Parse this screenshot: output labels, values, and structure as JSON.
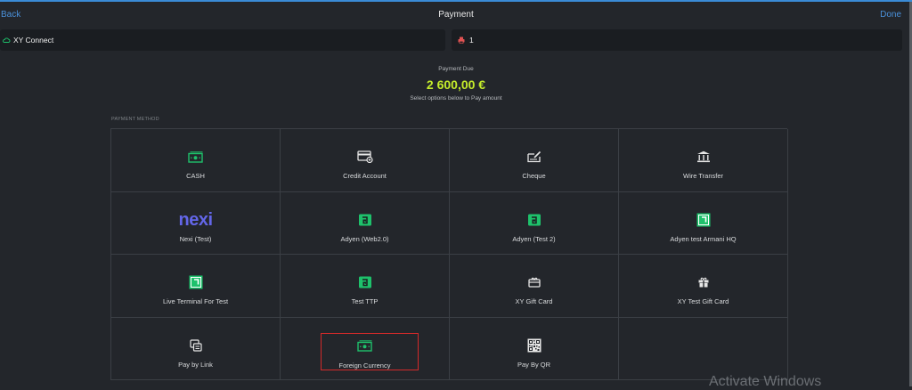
{
  "header": {
    "back_label": "Back",
    "title": "Payment",
    "done_label": "Done"
  },
  "status": {
    "connection_label": "XY Connect",
    "printer_count": "1"
  },
  "payment": {
    "due_label": "Payment Due",
    "amount": "2 600,00 €",
    "hint": "Select options below to Pay amount",
    "section_label": "PAYMENT METHOD"
  },
  "methods": [
    {
      "label": "CASH",
      "icon": "cash-icon"
    },
    {
      "label": "Credit Account",
      "icon": "credit-account-icon"
    },
    {
      "label": "Cheque",
      "icon": "cheque-icon"
    },
    {
      "label": "Wire Transfer",
      "icon": "bank-icon"
    },
    {
      "label": "Nexi (Test)",
      "icon": "nexi-logo",
      "logo_text": "nexi"
    },
    {
      "label": "Adyen (Web2.0)",
      "icon": "adyen-icon"
    },
    {
      "label": "Adyen (Test 2)",
      "icon": "adyen-icon"
    },
    {
      "label": "Adyen test Armani HQ",
      "icon": "terminal-icon"
    },
    {
      "label": "Live Terminal For Test",
      "icon": "terminal-icon"
    },
    {
      "label": "Test TTP",
      "icon": "adyen-icon"
    },
    {
      "label": "XY Gift Card",
      "icon": "gift-card-icon"
    },
    {
      "label": "XY Test Gift Card",
      "icon": "gift-icon"
    },
    {
      "label": "Pay by Link",
      "icon": "pay-by-link-icon"
    },
    {
      "label": "Foreign Currency",
      "icon": "cash-icon",
      "selected": true
    },
    {
      "label": "Pay By QR",
      "icon": "qr-code-icon"
    }
  ],
  "watermark": "Activate Windows",
  "colors": {
    "accent": "#4a90d9",
    "amount": "#c4ec2b",
    "green": "#1ec16b",
    "nexi": "#6366e8",
    "selection": "#d32a2a"
  }
}
